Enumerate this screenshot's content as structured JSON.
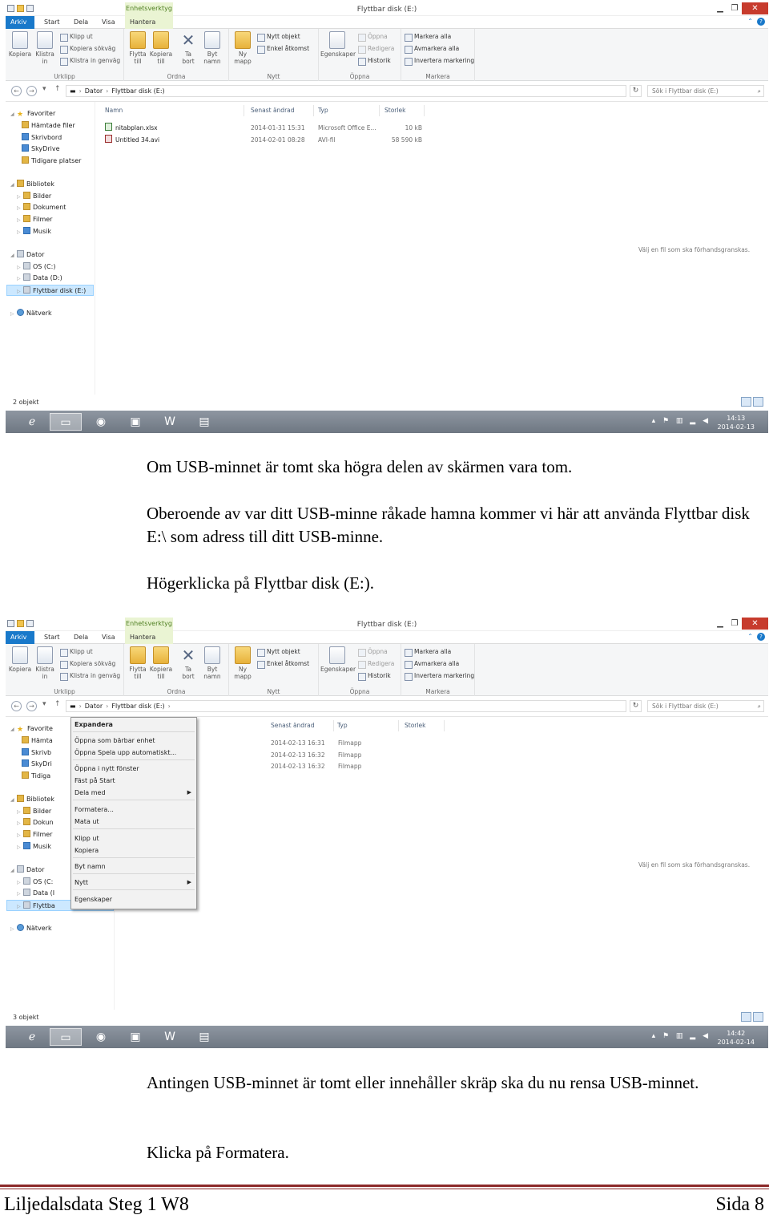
{
  "ribbon": {
    "context_tab": "Enhetsverktyg",
    "tabs": [
      "Arkiv",
      "Start",
      "Dela",
      "Visa",
      "Hantera"
    ],
    "groups": {
      "clipboard": {
        "label": "Urklipp",
        "copy": "Kopiera",
        "paste_1": "Klistra",
        "paste_2": "in",
        "cut": "Klipp ut",
        "copy_path": "Kopiera sökväg",
        "paste_shortcut": "Klistra in genväg"
      },
      "organize": {
        "label": "Ordna",
        "move_1": "Flytta",
        "move_2": "till",
        "copyto_1": "Kopiera",
        "copyto_2": "till",
        "delete_1": "Ta",
        "delete_2": "bort",
        "rename_1": "Byt",
        "rename_2": "namn"
      },
      "new": {
        "label": "Nytt",
        "newfolder_1": "Ny",
        "newfolder_2": "mapp",
        "new_item": "Nytt objekt",
        "easy_access": "Enkel åtkomst"
      },
      "open": {
        "label": "Öppna",
        "properties": "Egenskaper",
        "open": "Öppna",
        "edit": "Redigera",
        "history": "Historik"
      },
      "select": {
        "label": "Markera",
        "select_all": "Markera alla",
        "select_none": "Avmarkera alla",
        "invert": "Invertera markering"
      }
    }
  },
  "address": {
    "crumbs": [
      "Dator",
      "Flyttbar disk (E:)"
    ],
    "search_placeholder": "Sök i Flyttbar disk (E:)"
  },
  "navtree": {
    "favorites": "Favoriter",
    "downloads": "Hämtade filer",
    "desktop": "Skrivbord",
    "skydrive": "SkyDrive",
    "recent": "Tidigare platser",
    "libraries": "Bibliotek",
    "pictures": "Bilder",
    "documents": "Dokument",
    "videos": "Filmer",
    "music": "Musik",
    "computer": "Dator",
    "os": "OS (C:)",
    "data": "Data (D:)",
    "removable": "Flyttbar disk (E:)",
    "network": "Nätverk"
  },
  "navtree_cropped": {
    "favorites": "Favorite",
    "downloads": "Hämta",
    "desktop": "Skrivb",
    "skydrive": "SkyDri",
    "recent": "Tidiga",
    "libraries": "Bibliotek",
    "pictures": "Bilder",
    "documents": "Dokun",
    "videos": "Filmer",
    "music": "Musik",
    "computer": "Dator",
    "os": "OS (C:",
    "data": "Data (I",
    "removable": "Flyttba",
    "network": "Nätverk"
  },
  "screen1": {
    "window_title": "Flyttbar disk (E:)",
    "columns": [
      "Namn",
      "Senast ändrad",
      "Typ",
      "Storlek"
    ],
    "files": [
      {
        "name": "nitabplan.xlsx",
        "modified": "2014-01-31 15:31",
        "type": "Microsoft Office E...",
        "size": "10 kB"
      },
      {
        "name": "Untitled 34.avi",
        "modified": "2014-02-01 08:28",
        "type": "AVI-fil",
        "size": "58 590 kB"
      }
    ],
    "preview_text": "Välj en fil som ska förhandsgranskas.",
    "status": "2 objekt",
    "clock_time": "14:13",
    "clock_date": "2014-02-13"
  },
  "screen2": {
    "window_title": "Flyttbar disk (E:)",
    "columns": [
      "Senast ändrad",
      "Typ",
      "Storlek"
    ],
    "files": [
      {
        "modified": "2014-02-13 16:31",
        "type": "Filmapp"
      },
      {
        "modified": "2014-02-13 16:32",
        "type": "Filmapp"
      },
      {
        "modified": "2014-02-13 16:32",
        "type": "Filmapp"
      }
    ],
    "context_menu": [
      "Expandera",
      "Öppna som bärbar enhet",
      "Öppna Spela upp automatiskt...",
      "Öppna i nytt fönster",
      "Fäst på Start",
      "Dela med",
      "Formatera...",
      "Mata ut",
      "Klipp ut",
      "Kopiera",
      "Byt namn",
      "Nytt",
      "Egenskaper"
    ],
    "preview_text": "Välj en fil som ska förhandsgranskas.",
    "status": "3 objekt",
    "clock_time": "14:42",
    "clock_date": "2014-02-14"
  },
  "text": {
    "p1": "Om USB-minnet är tomt ska högra delen av skärmen vara tom.",
    "p2": "Oberoende av var ditt USB-minne råkade hamna kommer vi här att använda Flyttbar disk E:\\ som adress till ditt USB-minne.",
    "p3": "Högerklicka på Flyttbar disk (E:).",
    "p4": "Antingen USB-minnet är tomt eller innehåller skräp ska du nu rensa USB-minnet.",
    "p5": "Klicka på Formatera."
  },
  "footer": {
    "left": "Liljedalsdata Steg 1 W8",
    "right": "Sida 8"
  },
  "colors": {
    "accent": "#1979ca",
    "close": "#c73b2d",
    "context_tab": "#eaf4d3",
    "footer_rule": "#8c2a2a"
  }
}
